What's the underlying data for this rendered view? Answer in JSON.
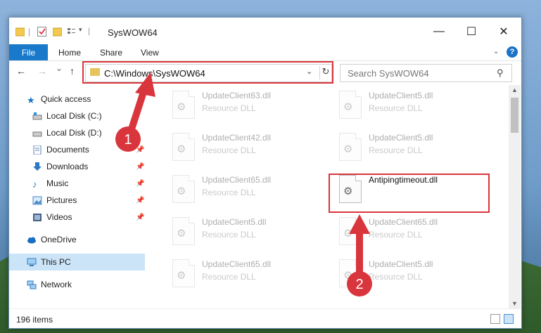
{
  "window": {
    "title": "SysWOW64",
    "controls": {
      "minimize": "—",
      "maximize": "☐",
      "close": "✕"
    }
  },
  "ribbon": {
    "tabs": [
      "File",
      "Home",
      "Share",
      "View"
    ],
    "help": "?"
  },
  "navigation": {
    "back": "←",
    "forward": "→",
    "recent": "⌄",
    "up": "↑",
    "address": "C:\\Windows\\SysWOW64",
    "search_placeholder": "Search SysWOW64"
  },
  "sidebar": {
    "items": [
      {
        "label": "Quick access",
        "icon": "star-icon",
        "pinned": false
      },
      {
        "label": "Local Disk (C:)",
        "icon": "drive-icon",
        "pinned": false
      },
      {
        "label": "Local Disk (D:)",
        "icon": "drive-icon",
        "pinned": false
      },
      {
        "label": "Documents",
        "icon": "documents-icon",
        "pinned": true
      },
      {
        "label": "Downloads",
        "icon": "download-arrow-icon",
        "pinned": true
      },
      {
        "label": "Music",
        "icon": "music-note-icon",
        "pinned": true
      },
      {
        "label": "Pictures",
        "icon": "pictures-icon",
        "pinned": true
      },
      {
        "label": "Videos",
        "icon": "film-icon",
        "pinned": true
      },
      {
        "label": "OneDrive",
        "icon": "cloud-icon",
        "pinned": false
      },
      {
        "label": "This PC",
        "icon": "computer-icon",
        "pinned": false,
        "selected": true
      },
      {
        "label": "Network",
        "icon": "network-icon",
        "pinned": false
      }
    ]
  },
  "files": [
    {
      "name": "UpdateClient63.dll",
      "type": "Resource DLL"
    },
    {
      "name": "UpdateClient5.dll",
      "type": "Resource DLL"
    },
    {
      "name": "UpdateClient42.dll",
      "type": "Resource DLL"
    },
    {
      "name": "UpdateClient5.dll",
      "type": "Resource DLL"
    },
    {
      "name": "UpdateClient65.dll",
      "type": "Resource DLL"
    },
    {
      "name": "Antipingtimeout.dll",
      "type": "",
      "highlighted": true
    },
    {
      "name": "UpdateClient5.dll",
      "type": "Resource DLL"
    },
    {
      "name": "UpdateClient65.dll",
      "type": "Resource DLL"
    },
    {
      "name": "UpdateClient65.dll",
      "type": "Resource DLL"
    },
    {
      "name": "UpdateClient5.dll",
      "type": "Resource DLL"
    }
  ],
  "status": {
    "item_count": "196 items"
  },
  "annotations": {
    "step1": "1",
    "step2": "2",
    "accent_color": "#d9353c"
  },
  "colors": {
    "file_tab": "#1979ca",
    "selected_nav": "#cce4f7"
  }
}
